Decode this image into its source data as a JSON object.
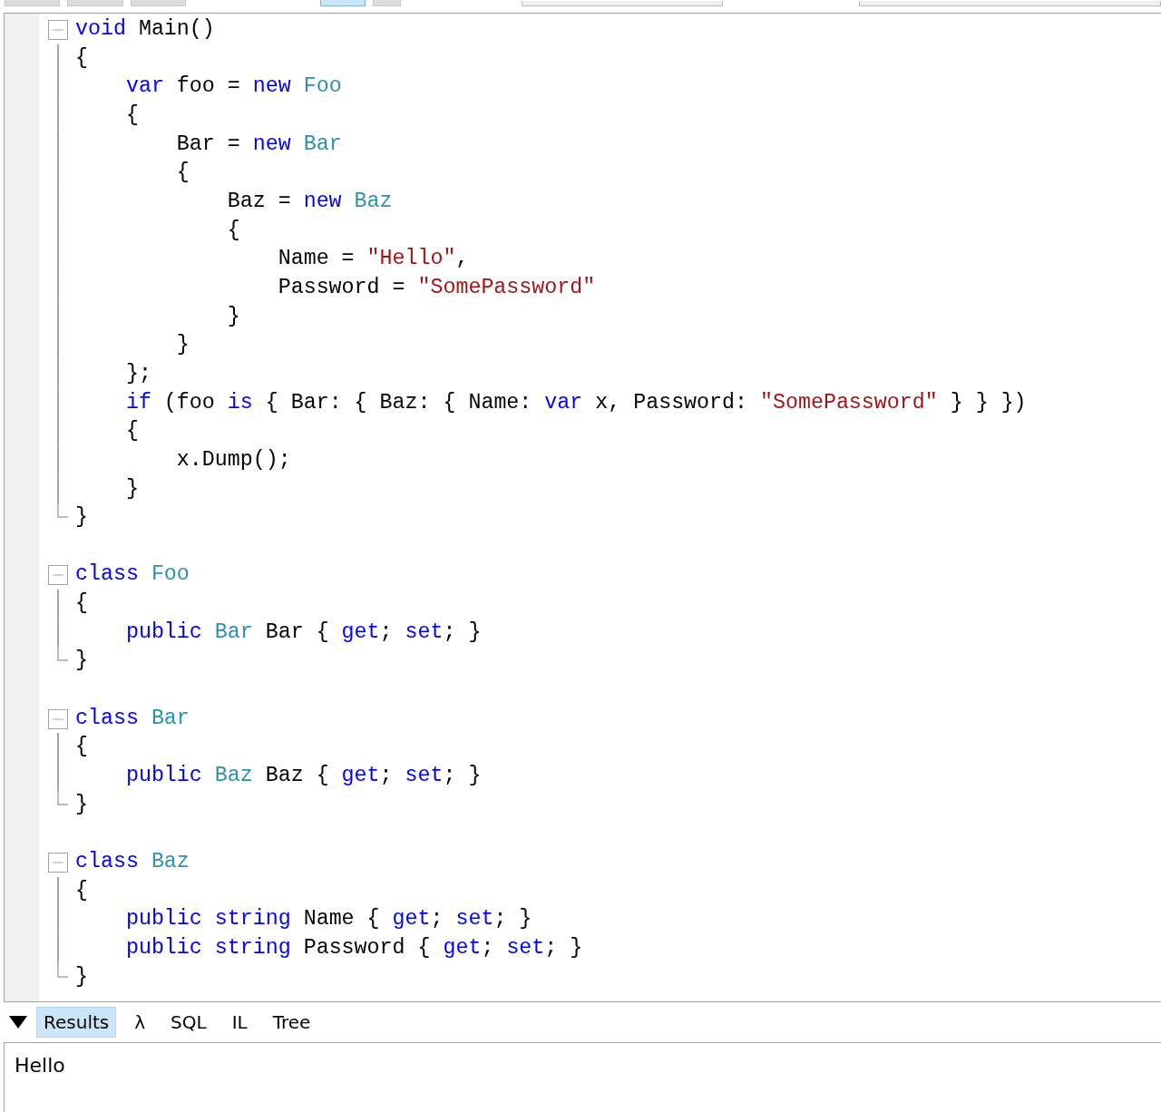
{
  "toolbar": {
    "buttons": [
      {
        "selected": false
      },
      {
        "selected": false
      },
      {
        "selected": false
      },
      {
        "selected": true
      },
      {
        "selected": false
      }
    ]
  },
  "editor": {
    "lines": [
      {
        "kind": "fold_start",
        "tokens": [
          {
            "kind": "keyword",
            "text": "void"
          },
          {
            "kind": "plain",
            "text": " Main()"
          }
        ]
      },
      {
        "kind": "fold_body",
        "tokens": [
          {
            "kind": "plain",
            "text": "{"
          }
        ]
      },
      {
        "kind": "fold_body",
        "tokens": [
          {
            "kind": "keyword",
            "text": "    var"
          },
          {
            "kind": "plain",
            "text": " foo = "
          },
          {
            "kind": "keyword",
            "text": "new"
          },
          {
            "kind": "type",
            "text": " Foo"
          }
        ]
      },
      {
        "kind": "fold_body",
        "tokens": [
          {
            "kind": "plain",
            "text": "    {"
          }
        ]
      },
      {
        "kind": "fold_body",
        "tokens": [
          {
            "kind": "plain",
            "text": "        Bar = "
          },
          {
            "kind": "keyword",
            "text": "new"
          },
          {
            "kind": "type",
            "text": " Bar"
          }
        ]
      },
      {
        "kind": "fold_body",
        "tokens": [
          {
            "kind": "plain",
            "text": "        {"
          }
        ]
      },
      {
        "kind": "fold_body",
        "tokens": [
          {
            "kind": "plain",
            "text": "            Baz = "
          },
          {
            "kind": "keyword",
            "text": "new"
          },
          {
            "kind": "type",
            "text": " Baz"
          }
        ]
      },
      {
        "kind": "fold_body",
        "tokens": [
          {
            "kind": "plain",
            "text": "            {"
          }
        ]
      },
      {
        "kind": "fold_body",
        "tokens": [
          {
            "kind": "plain",
            "text": "                Name = "
          },
          {
            "kind": "string",
            "text": "\"Hello\""
          },
          {
            "kind": "plain",
            "text": ","
          }
        ]
      },
      {
        "kind": "fold_body",
        "tokens": [
          {
            "kind": "plain",
            "text": "                Password = "
          },
          {
            "kind": "string",
            "text": "\"SomePassword\""
          }
        ]
      },
      {
        "kind": "fold_body",
        "tokens": [
          {
            "kind": "plain",
            "text": "            }"
          }
        ]
      },
      {
        "kind": "fold_body",
        "tokens": [
          {
            "kind": "plain",
            "text": "        }"
          }
        ]
      },
      {
        "kind": "fold_body",
        "tokens": [
          {
            "kind": "plain",
            "text": "    };"
          }
        ]
      },
      {
        "kind": "fold_body",
        "tokens": [
          {
            "kind": "keyword",
            "text": "    if"
          },
          {
            "kind": "plain",
            "text": " (foo "
          },
          {
            "kind": "keyword",
            "text": "is"
          },
          {
            "kind": "plain",
            "text": " { Bar: { Baz: { Name: "
          },
          {
            "kind": "keyword",
            "text": "var"
          },
          {
            "kind": "plain",
            "text": " x, Password: "
          },
          {
            "kind": "string",
            "text": "\"SomePassword\""
          },
          {
            "kind": "plain",
            "text": " } } })"
          }
        ]
      },
      {
        "kind": "fold_body",
        "tokens": [
          {
            "kind": "plain",
            "text": "    {"
          }
        ]
      },
      {
        "kind": "fold_body",
        "tokens": [
          {
            "kind": "plain",
            "text": "        x.Dump();"
          }
        ]
      },
      {
        "kind": "fold_body",
        "tokens": [
          {
            "kind": "plain",
            "text": "    }"
          }
        ]
      },
      {
        "kind": "fold_end",
        "tokens": [
          {
            "kind": "plain",
            "text": "}"
          }
        ]
      },
      {
        "kind": "blank"
      },
      {
        "kind": "fold_start",
        "tokens": [
          {
            "kind": "keyword",
            "text": "class"
          },
          {
            "kind": "type",
            "text": " Foo"
          }
        ]
      },
      {
        "kind": "fold_body",
        "tokens": [
          {
            "kind": "plain",
            "text": "{"
          }
        ]
      },
      {
        "kind": "fold_body",
        "tokens": [
          {
            "kind": "keyword",
            "text": "    public"
          },
          {
            "kind": "type",
            "text": " Bar"
          },
          {
            "kind": "plain",
            "text": " Bar { "
          },
          {
            "kind": "keyword",
            "text": "get"
          },
          {
            "kind": "plain",
            "text": "; "
          },
          {
            "kind": "keyword",
            "text": "set"
          },
          {
            "kind": "plain",
            "text": "; }"
          }
        ]
      },
      {
        "kind": "fold_end",
        "tokens": [
          {
            "kind": "plain",
            "text": "}"
          }
        ]
      },
      {
        "kind": "blank"
      },
      {
        "kind": "fold_start",
        "tokens": [
          {
            "kind": "keyword",
            "text": "class"
          },
          {
            "kind": "type",
            "text": " Bar"
          }
        ]
      },
      {
        "kind": "fold_body",
        "tokens": [
          {
            "kind": "plain",
            "text": "{"
          }
        ]
      },
      {
        "kind": "fold_body",
        "tokens": [
          {
            "kind": "keyword",
            "text": "    public"
          },
          {
            "kind": "type",
            "text": " Baz"
          },
          {
            "kind": "plain",
            "text": " Baz { "
          },
          {
            "kind": "keyword",
            "text": "get"
          },
          {
            "kind": "plain",
            "text": "; "
          },
          {
            "kind": "keyword",
            "text": "set"
          },
          {
            "kind": "plain",
            "text": "; }"
          }
        ]
      },
      {
        "kind": "fold_end",
        "tokens": [
          {
            "kind": "plain",
            "text": "}"
          }
        ]
      },
      {
        "kind": "blank"
      },
      {
        "kind": "fold_start",
        "tokens": [
          {
            "kind": "keyword",
            "text": "class"
          },
          {
            "kind": "type",
            "text": " Baz"
          }
        ]
      },
      {
        "kind": "fold_body",
        "tokens": [
          {
            "kind": "plain",
            "text": "{"
          }
        ]
      },
      {
        "kind": "fold_body",
        "tokens": [
          {
            "kind": "keyword",
            "text": "    public"
          },
          {
            "kind": "keyword",
            "text": " string"
          },
          {
            "kind": "plain",
            "text": " Name { "
          },
          {
            "kind": "keyword",
            "text": "get"
          },
          {
            "kind": "plain",
            "text": "; "
          },
          {
            "kind": "keyword",
            "text": "set"
          },
          {
            "kind": "plain",
            "text": "; }"
          }
        ]
      },
      {
        "kind": "fold_body",
        "tokens": [
          {
            "kind": "keyword",
            "text": "    public"
          },
          {
            "kind": "keyword",
            "text": " string"
          },
          {
            "kind": "plain",
            "text": " Password { "
          },
          {
            "kind": "keyword",
            "text": "get"
          },
          {
            "kind": "plain",
            "text": "; "
          },
          {
            "kind": "keyword",
            "text": "set"
          },
          {
            "kind": "plain",
            "text": "; }"
          }
        ]
      },
      {
        "kind": "fold_end",
        "tokens": [
          {
            "kind": "plain",
            "text": "}"
          }
        ]
      }
    ]
  },
  "result_tabs": [
    {
      "label": "Results",
      "selected": true
    },
    {
      "label": "λ",
      "selected": false
    },
    {
      "label": "SQL",
      "selected": false
    },
    {
      "label": "IL",
      "selected": false
    },
    {
      "label": "Tree",
      "selected": false
    }
  ],
  "output": {
    "text": "Hello"
  }
}
